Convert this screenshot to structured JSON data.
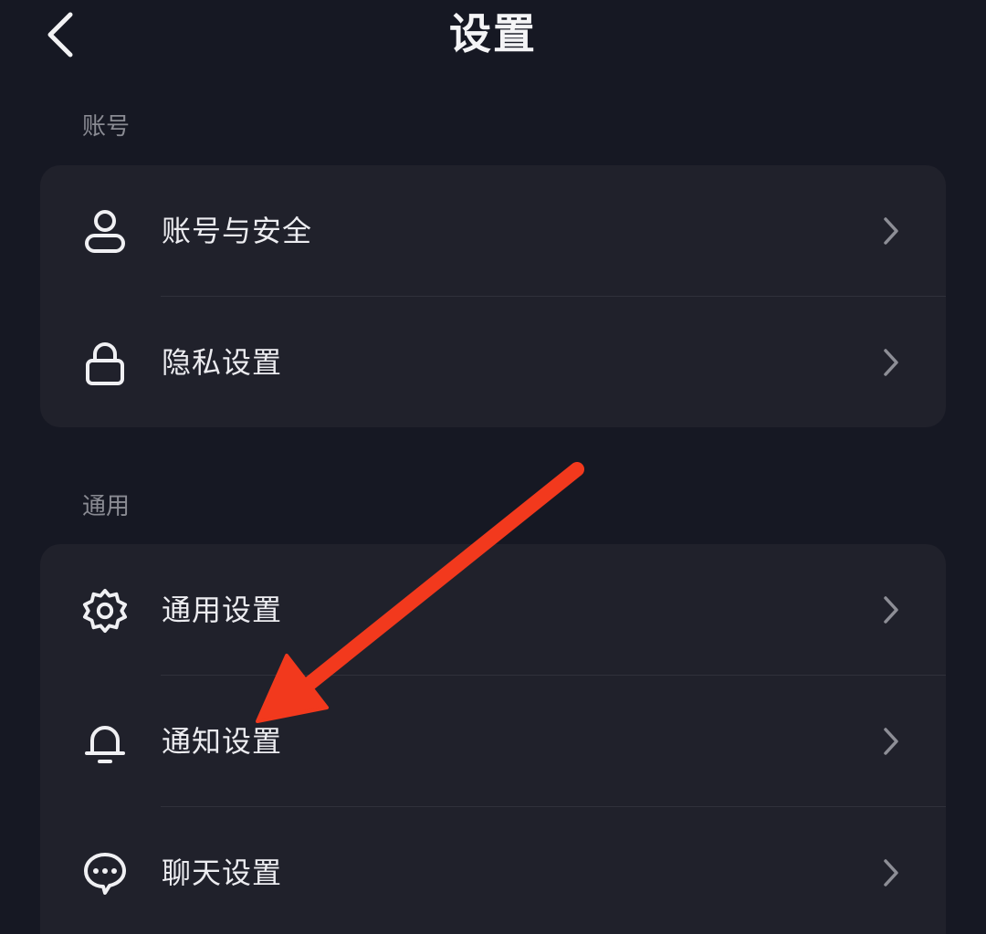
{
  "header": {
    "title": "设置",
    "back_icon": "chevron-left-icon"
  },
  "sections": [
    {
      "title": "账号",
      "items": [
        {
          "label": "账号与安全",
          "icon": "user-icon"
        },
        {
          "label": "隐私设置",
          "icon": "lock-icon"
        }
      ]
    },
    {
      "title": "通用",
      "items": [
        {
          "label": "通用设置",
          "icon": "gear-icon"
        },
        {
          "label": "通知设置",
          "icon": "bell-icon"
        },
        {
          "label": "聊天设置",
          "icon": "chat-bubble-icon"
        }
      ]
    }
  ],
  "colors": {
    "background": "#161823",
    "card": "#20212b",
    "annotation_arrow": "#f2391d"
  },
  "annotation": {
    "icon": "red-arrow-icon",
    "points_to": "通知设置"
  }
}
